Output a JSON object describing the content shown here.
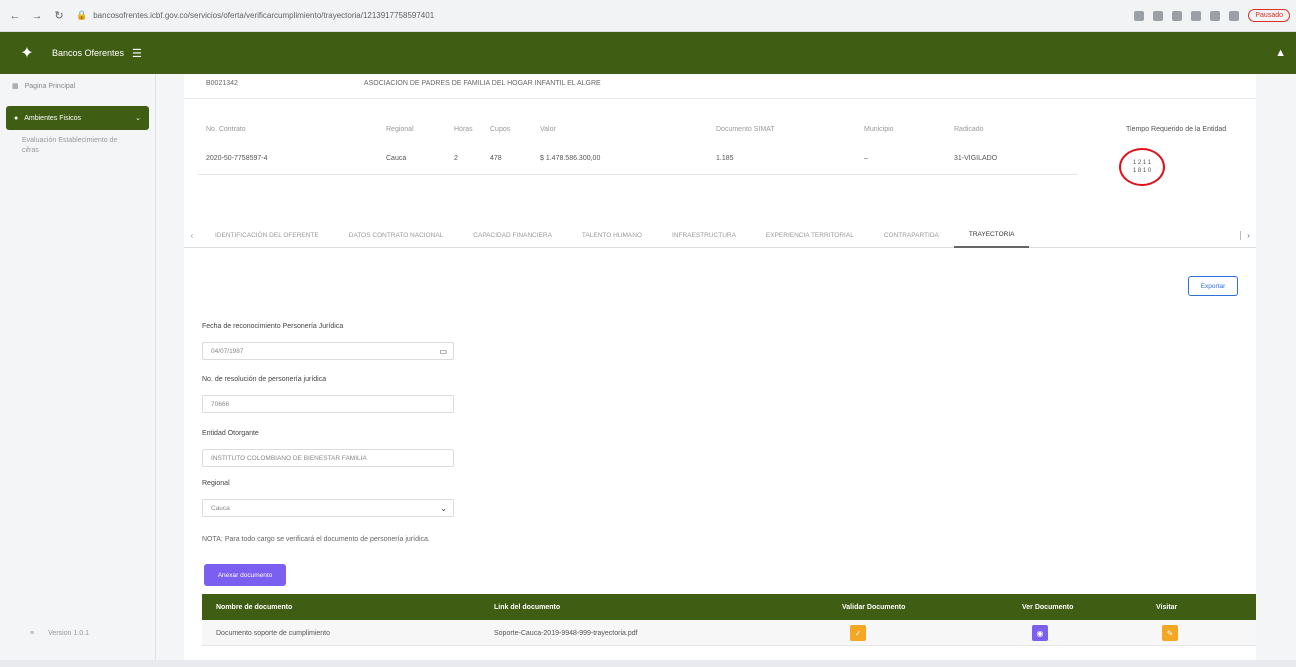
{
  "browser": {
    "url": "bancosofrentes.icbf.gov.co/servicios/oferta/verificarcumplimiento/trayectoria/1213917758597401",
    "profile_label": "Pausado"
  },
  "appbar": {
    "title": "Bancos Oferentes"
  },
  "sidebar": {
    "home_label": "Pagina Principal",
    "active_label": "Ambientes Fisicos",
    "sub_label": "Evaluación Establecimiento de cifras",
    "version_label": "Version 1.0.1"
  },
  "record": {
    "code": "B0021342",
    "name": "ASOCIACION DE PADRES DE FAMILIA DEL HOGAR INFANTIL EL ALGRE"
  },
  "info": {
    "headers": [
      "No. Contrato",
      "Regional",
      "Horas",
      "Cupos",
      "Valor",
      "Documento SIMAT",
      "Municipio",
      "Radicado"
    ],
    "values": [
      "2020-50-7758597-4",
      "Cauca",
      "2",
      "478",
      "$ 1.478.586.300,00",
      "1.185",
      "–",
      "31-VIGILADO"
    ],
    "tiempo_label": "Tiempo Requerido de la Entidad",
    "tiempo_values": [
      "1 2 1 1",
      "1 8 1 0"
    ]
  },
  "tabs": [
    "IDENTIFICACIÓN DEL OFERENTE",
    "DATOS CONTRATO NACIONAL",
    "CAPACIDAD FINANCIERA",
    "TALENTO HUMANO",
    "INFRAESTRUCTURA",
    "EXPERIENCIA TERRITORIAL",
    "CONTRAPARTIDA",
    "TRAYECTORIA"
  ],
  "export_label": "Exportar",
  "form": {
    "fecha_label": "Fecha de reconocimiento Personería Jurídica",
    "fecha_value": "04/07/1987",
    "acto_label": "No. de resolución de personería jurídica",
    "acto_value": "70666",
    "entidad_label": "Entidad Otorgante",
    "entidad_value": "INSTITUTO COLOMBIANO DE BIENESTAR FAMILIA",
    "regional_label": "Regional",
    "regional_value": "Cauca"
  },
  "note": "NOTA: Para todo cargo se verificará el documento de personería jurídica.",
  "add_doc_label": "Anexar documento",
  "doc_table": {
    "headers": [
      "Nombre de documento",
      "Link del documento",
      "Validar Documento",
      "Ver Documento",
      "Visitar"
    ],
    "rows": [
      {
        "name": "Documento soporte de cumplimiento",
        "link": "Soporte-Cauca-2019-9948-999-trayectoria.pdf"
      }
    ]
  }
}
